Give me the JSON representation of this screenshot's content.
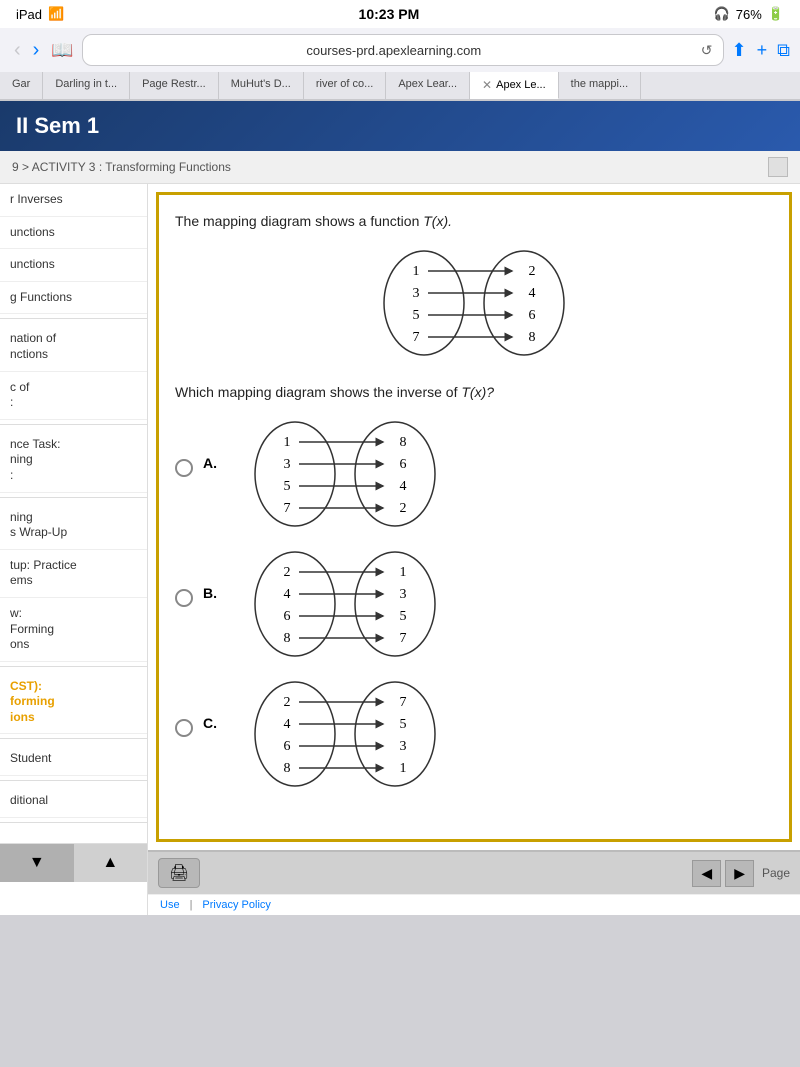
{
  "statusBar": {
    "device": "iPad",
    "time": "10:23 PM",
    "battery": "76%",
    "headphones": true
  },
  "browser": {
    "url": "courses-prd.apexlearning.com",
    "tabs": [
      {
        "id": "gar",
        "label": "Gar",
        "active": false
      },
      {
        "id": "darling",
        "label": "Darling in t...",
        "active": false
      },
      {
        "id": "page-restr",
        "label": "Page Restr...",
        "active": false
      },
      {
        "id": "muhuts",
        "label": "MuHut's D...",
        "active": false
      },
      {
        "id": "river",
        "label": "river of co...",
        "active": false
      },
      {
        "id": "apex1",
        "label": "Apex Lear...",
        "active": false
      },
      {
        "id": "apex2",
        "label": "Apex Le...",
        "active": true,
        "hasClose": true
      },
      {
        "id": "mapping",
        "label": "the mappi...",
        "active": false
      }
    ]
  },
  "pageHeader": {
    "title": "II Sem 1"
  },
  "breadcrumb": {
    "text": "9 > ACTIVITY 3 : Transforming Functions"
  },
  "sidebar": {
    "items": [
      {
        "id": "inverses",
        "label": "r Inverses",
        "active": false
      },
      {
        "id": "functions1",
        "label": "unctions",
        "active": false
      },
      {
        "id": "functions2",
        "label": "unctions",
        "active": false
      },
      {
        "id": "g-functions",
        "label": "g Functions",
        "active": false
      },
      {
        "id": "nation",
        "label": "nation of\nnctions",
        "active": false
      },
      {
        "id": "c-of",
        "label": "c of\n:",
        "active": false
      },
      {
        "id": "nce-task",
        "label": "nce Task:\nning\n:",
        "active": false
      },
      {
        "id": "ning",
        "label": "ning\ns Wrap-Up",
        "active": false
      },
      {
        "id": "tup",
        "label": "tup: Practice\nems",
        "active": false
      },
      {
        "id": "w-performing",
        "label": "w:\nForming\nons",
        "active": false
      },
      {
        "id": "cst",
        "label": "CST):\nforming\nions",
        "active": true
      },
      {
        "id": "student",
        "label": "Student",
        "active": false
      },
      {
        "id": "ditional",
        "label": "ditional",
        "active": false
      }
    ],
    "footerBtns": [
      {
        "id": "prev",
        "symbol": "▼"
      },
      {
        "id": "up",
        "symbol": "▲"
      }
    ]
  },
  "content": {
    "questionText": "The mapping diagram shows a function ",
    "functionName": "T(x).",
    "questionText2": "Which mapping diagram shows the inverse of ",
    "functionName2": "T(x)?",
    "mainDiagram": {
      "left": [
        "1",
        "3",
        "5",
        "7"
      ],
      "right": [
        "2",
        "4",
        "6",
        "8"
      ]
    },
    "options": [
      {
        "id": "A",
        "label": "A.",
        "left": [
          "1",
          "3",
          "5",
          "7"
        ],
        "right": [
          "8",
          "6",
          "4",
          "2"
        ]
      },
      {
        "id": "B",
        "label": "B.",
        "left": [
          "2",
          "4",
          "6",
          "8"
        ],
        "right": [
          "1",
          "3",
          "5",
          "7"
        ]
      },
      {
        "id": "C",
        "label": "C.",
        "left": [
          "2",
          "4",
          "6",
          "8"
        ],
        "right": [
          "7",
          "5",
          "3",
          "1"
        ]
      }
    ]
  },
  "bottomBar": {
    "printLabel": "🖨",
    "prevLabel": "◀",
    "nextLabel": "▶",
    "pageLabel": "Page"
  },
  "footer": {
    "useLabel": "Use",
    "privacyLabel": "Privacy Policy"
  }
}
